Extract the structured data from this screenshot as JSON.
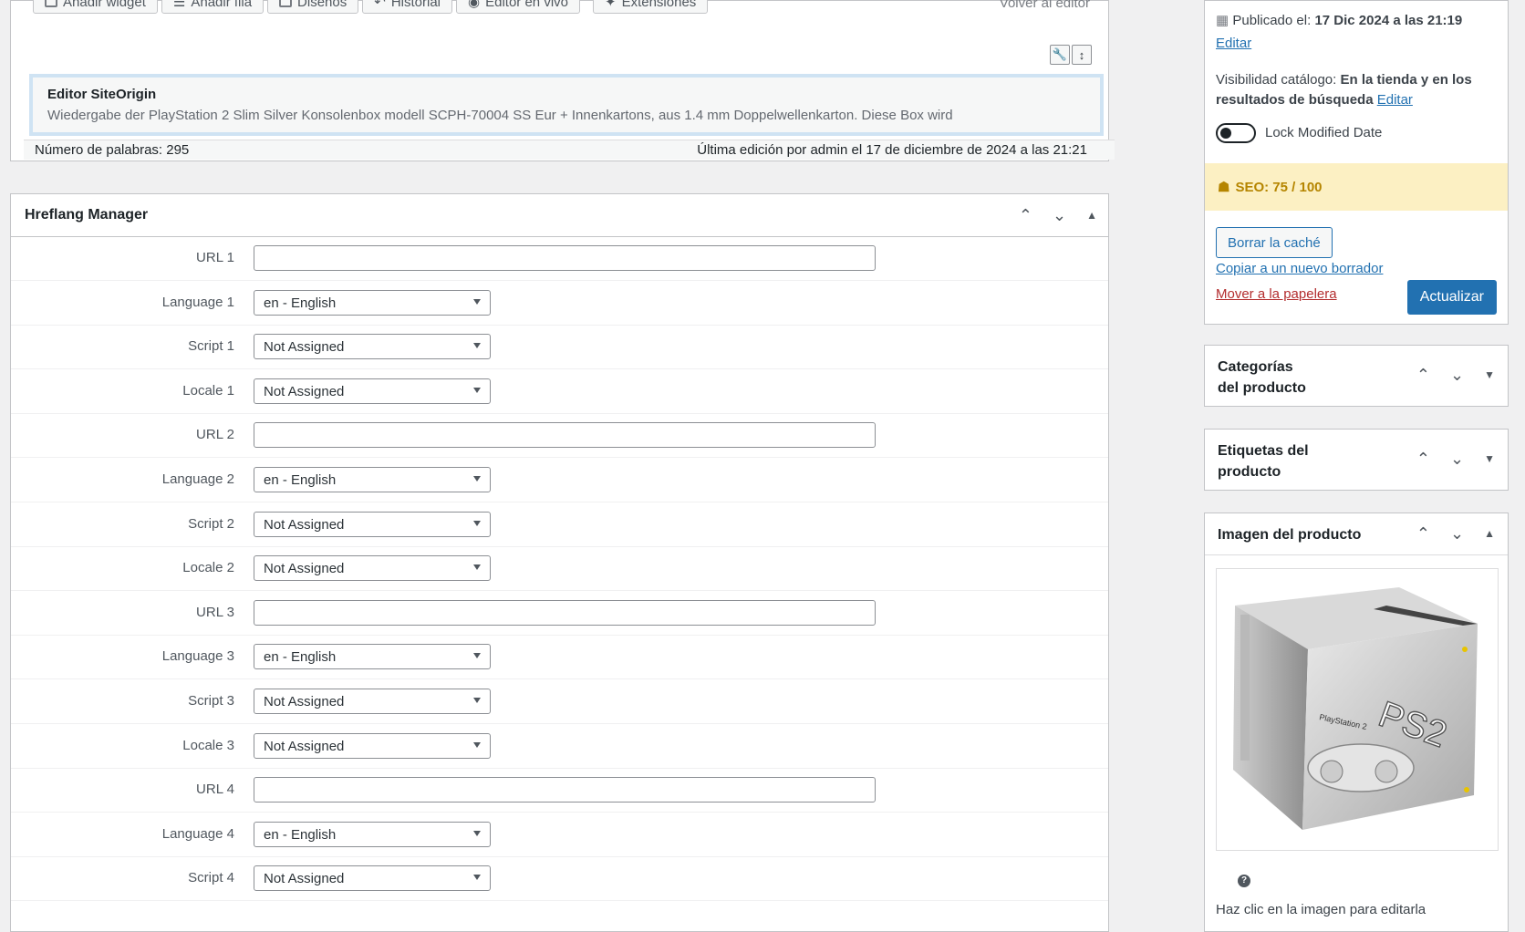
{
  "editor": {
    "toolbar": [
      "Añadir widget",
      "Añadir fila",
      "Diseños",
      "Historial",
      "Editor en vivo",
      "Extensiones"
    ],
    "back_to_editor": "Volver al editor",
    "widget": {
      "title": "Editor SiteOrigin",
      "description": "Wiedergabe der PlayStation 2 Slim Silver Konsolenbox modell SCPH-70004 SS Eur + Innenkartons, aus 1.4 mm Doppelwellenkarton. Diese Box wird"
    },
    "word_count": "Número de palabras: 295",
    "last_edit": "Última edición por admin el 17 de diciembre de 2024 a las 21:21"
  },
  "hreflang": {
    "title": "Hreflang Manager",
    "rows": [
      {
        "label": "URL 1",
        "type": "url",
        "value": ""
      },
      {
        "label": "Language 1",
        "type": "select",
        "value": "en - English"
      },
      {
        "label": "Script 1",
        "type": "select",
        "value": "Not Assigned"
      },
      {
        "label": "Locale 1",
        "type": "select",
        "value": "Not Assigned"
      },
      {
        "label": "URL 2",
        "type": "url",
        "value": ""
      },
      {
        "label": "Language 2",
        "type": "select",
        "value": "en - English"
      },
      {
        "label": "Script 2",
        "type": "select",
        "value": "Not Assigned"
      },
      {
        "label": "Locale 2",
        "type": "select",
        "value": "Not Assigned"
      },
      {
        "label": "URL 3",
        "type": "url",
        "value": ""
      },
      {
        "label": "Language 3",
        "type": "select",
        "value": "en - English"
      },
      {
        "label": "Script 3",
        "type": "select",
        "value": "Not Assigned"
      },
      {
        "label": "Locale 3",
        "type": "select",
        "value": "Not Assigned"
      },
      {
        "label": "URL 4",
        "type": "url",
        "value": ""
      },
      {
        "label": "Language 4",
        "type": "select",
        "value": "en - English"
      },
      {
        "label": "Script 4",
        "type": "select",
        "value": "Not Assigned"
      }
    ]
  },
  "publish": {
    "published_label": "Publicado el:",
    "published_date": "17 Dic 2024 a las 21:19",
    "edit": "Editar",
    "visibility_label": "Visibilidad catálogo:",
    "visibility_value_1": "En la tienda y en los",
    "visibility_value_2": "resultados de búsqueda",
    "visibility_edit": "Editar",
    "lock_label": "Lock Modified Date",
    "seo": "SEO: 75 / 100",
    "clear_cache": "Borrar la caché",
    "copy_draft": "Copiar a un nuevo borrador",
    "trash": "Mover a la papelera",
    "update": "Actualizar"
  },
  "categories": {
    "line1": "Categorías",
    "line2": "del producto"
  },
  "tags": {
    "line1": "Etiquetas del",
    "line2": "producto"
  },
  "product_image": {
    "title": "Imagen del producto",
    "hint": "Haz clic en la imagen para editarla",
    "box_text": "PS2",
    "box_subtext": "PlayStation 2"
  },
  "colors": {
    "accent": "#2271b1",
    "seo_bg": "#fcf0c3",
    "seo_text": "#b58500"
  }
}
